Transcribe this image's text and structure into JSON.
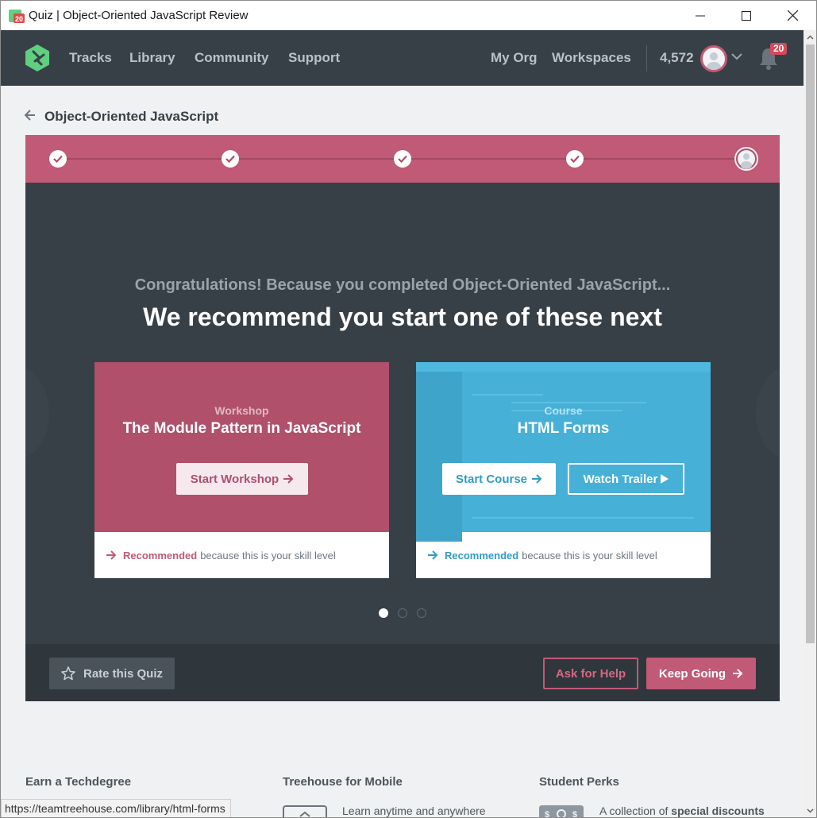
{
  "window": {
    "title": "Quiz | Object-Oriented JavaScript Review",
    "app_icon": "treehouse-20-icon"
  },
  "nav": {
    "links": [
      "Tracks",
      "Library",
      "Community",
      "Support"
    ],
    "right_links": [
      "My Org",
      "Workspaces"
    ],
    "points": "4,572",
    "notification_count": "20"
  },
  "breadcrumb": {
    "label": "Object-Oriented JavaScript"
  },
  "progress": {
    "completed_steps": 4,
    "total_steps": 5
  },
  "main": {
    "congrats": "Congratulations! Because you completed Object-Oriented JavaScript...",
    "headline": "We recommend you start one of these next",
    "cards": [
      {
        "kicker": "Workshop",
        "title": "The Module Pattern in JavaScript",
        "primary_button": "Start Workshop",
        "recommended": "Recommended",
        "reason": "because this is your skill level",
        "color": "#b0506b"
      },
      {
        "kicker": "Course",
        "title": "HTML Forms",
        "primary_button": "Start Course",
        "secondary_button": "Watch Trailer",
        "recommended": "Recommended",
        "reason": "because this is your skill level",
        "color": "#47b0d6"
      }
    ],
    "carousel": {
      "pages": 3,
      "active": 1
    },
    "rate_button": "Rate this Quiz",
    "help_button": "Ask for Help",
    "keep_button": "Keep Going"
  },
  "footer": {
    "columns": [
      {
        "heading": "Earn a Techdegree",
        "text": ""
      },
      {
        "heading": "Treehouse for Mobile",
        "text": "Learn anytime and anywhere"
      },
      {
        "heading": "Student Perks",
        "text_pre": "A collection of",
        "text_bold": "special discounts"
      }
    ]
  },
  "status_bar": {
    "url": "https://teamtreehouse.com/library/html-forms"
  },
  "colors": {
    "nav_bg": "#384047",
    "accent_pink": "#c15a76",
    "accent_blue": "#47b0d6"
  }
}
